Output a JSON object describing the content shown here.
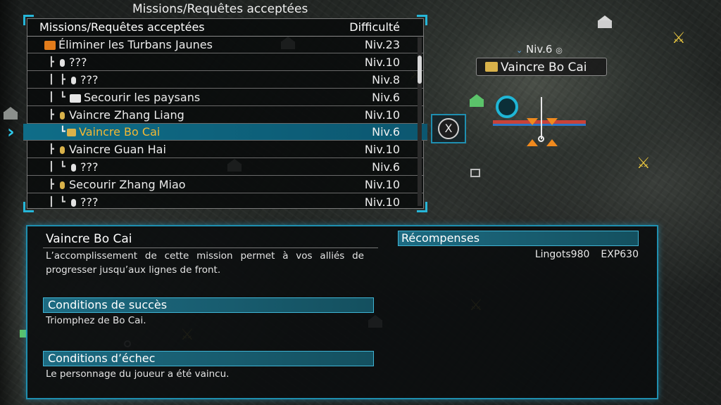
{
  "map": {
    "target_level": "Niv.6",
    "target_name": "Vaincre Bo Cai",
    "confirm_button": "X"
  },
  "missions": {
    "panel_title": "Missions/Requêtes acceptées",
    "header_left": "Missions/Requêtes acceptées",
    "header_right": "Difficulté",
    "rows": [
      {
        "label": "Éliminer les Turbans Jaunes",
        "level": "Niv.23"
      },
      {
        "label": "???",
        "level": "Niv.10"
      },
      {
        "label": "???",
        "level": "Niv.8"
      },
      {
        "label": "Secourir les paysans",
        "level": "Niv.6"
      },
      {
        "label": "Vaincre Zhang Liang",
        "level": "Niv.10"
      },
      {
        "label": "Vaincre Bo Cai",
        "level": "Niv.6"
      },
      {
        "label": "Vaincre Guan Hai",
        "level": "Niv.10"
      },
      {
        "label": "???",
        "level": "Niv.6"
      },
      {
        "label": "Secourir Zhang Miao",
        "level": "Niv.10"
      },
      {
        "label": "???",
        "level": "Niv.10"
      }
    ],
    "selected_index": 5
  },
  "detail": {
    "title": "Vaincre Bo Cai",
    "description": "L’accomplissement de cette mission permet à vos alliés de progresser jusqu’aux lignes de front.",
    "success_heading": "Conditions de succès",
    "success_text": "Triomphez de Bo Cai.",
    "failure_heading": "Conditions d’échec",
    "failure_text": "Le personnage du joueur a été vaincu.",
    "rewards_heading": "Récompenses",
    "reward_gold": "Lingots980",
    "reward_exp": "EXP630"
  },
  "colors": {
    "accent_cyan": "#1f8fb0",
    "selected_text": "#f3b833",
    "enemy_marker": "#e8c640"
  }
}
